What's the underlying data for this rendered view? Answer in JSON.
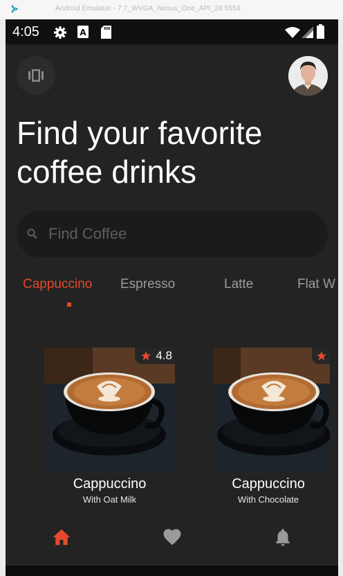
{
  "window": {
    "title": "Android Emulator - 7.7_WVGA_Nexus_One_API_28:5554"
  },
  "status_bar": {
    "time": "4:05",
    "icons": [
      "settings-icon",
      "a-notification-icon",
      "sd-card-icon",
      "wifi-icon",
      "cell-signal-icon",
      "battery-icon"
    ]
  },
  "header": {
    "menu_icon": "panel-menu-icon",
    "avatar": "profile-avatar"
  },
  "title": {
    "line1": "Find your favorite",
    "line2": "coffee drinks"
  },
  "search": {
    "placeholder": "Find Coffee",
    "value": ""
  },
  "tabs": [
    {
      "label": "Cappuccino",
      "active": true
    },
    {
      "label": "Espresso",
      "active": false
    },
    {
      "label": "Latte",
      "active": false
    },
    {
      "label": "Flat W",
      "active": false
    }
  ],
  "products": [
    {
      "name": "Cappuccino",
      "subtitle": "With Oat Milk",
      "rating": "4.8"
    },
    {
      "name": "Cappuccino",
      "subtitle": "With Chocolate",
      "rating": ""
    }
  ],
  "bottom_nav": [
    {
      "icon": "home-icon",
      "active": true
    },
    {
      "icon": "heart-icon",
      "active": false
    },
    {
      "icon": "bell-icon",
      "active": false
    }
  ],
  "colors": {
    "accent": "#e5492d",
    "background": "#232323",
    "search_bg": "#1b1b1b",
    "inactive_icon": "#9a9a9a"
  }
}
